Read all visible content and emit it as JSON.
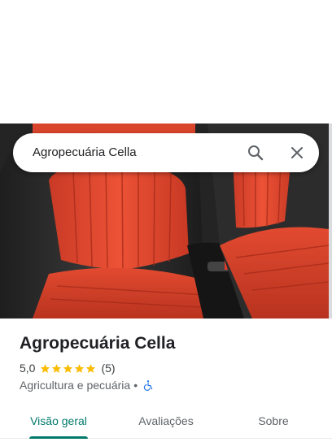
{
  "search": {
    "query": "Agropecuária Cella",
    "search_icon": "search-icon",
    "close_icon": "close-icon"
  },
  "place": {
    "name": "Agropecuária Cella",
    "rating": "5,0",
    "stars": 5,
    "review_count": "(5)",
    "category": "Agricultura e pecuária",
    "separator": "•",
    "accessibility_icon": "wheelchair-icon"
  },
  "tabs": [
    {
      "label": "Visão geral",
      "selected": true
    },
    {
      "label": "Avaliações",
      "selected": false
    },
    {
      "label": "Sobre",
      "selected": false
    }
  ],
  "colors": {
    "accent": "#00796b",
    "star": "#fbbc04",
    "seat_red": "#e8472f",
    "seat_black": "#2f2f2f",
    "access_blue": "#1a73e8"
  }
}
